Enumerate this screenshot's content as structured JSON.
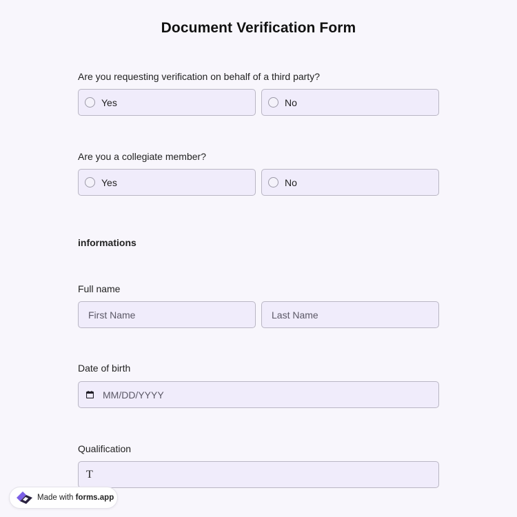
{
  "form": {
    "title": "Document Verification Form"
  },
  "q1": {
    "question": "Are you requesting verification on behalf of a third party?",
    "options": [
      "Yes",
      "No"
    ]
  },
  "q2": {
    "question": "Are you a collegiate member?",
    "options": [
      "Yes",
      "No"
    ]
  },
  "section": {
    "title": "informations"
  },
  "full_name": {
    "label": "Full name",
    "first_placeholder": "First Name",
    "last_placeholder": "Last Name"
  },
  "dob": {
    "label": "Date of birth",
    "placeholder": "MM/DD/YYYY",
    "icon": "calendar-icon"
  },
  "qualification": {
    "label": "Qualification",
    "icon": "text-t-icon",
    "icon_glyph": "T"
  },
  "badge": {
    "prefix": "Made with",
    "brand": "forms.app",
    "icon": "forms-app-logo"
  },
  "colors": {
    "background": "#f8f6fc",
    "field_fill": "#f0ecfb",
    "field_border": "#b9b6c4",
    "logo_purple": "#7b5fe6",
    "logo_dark": "#2a2240"
  }
}
